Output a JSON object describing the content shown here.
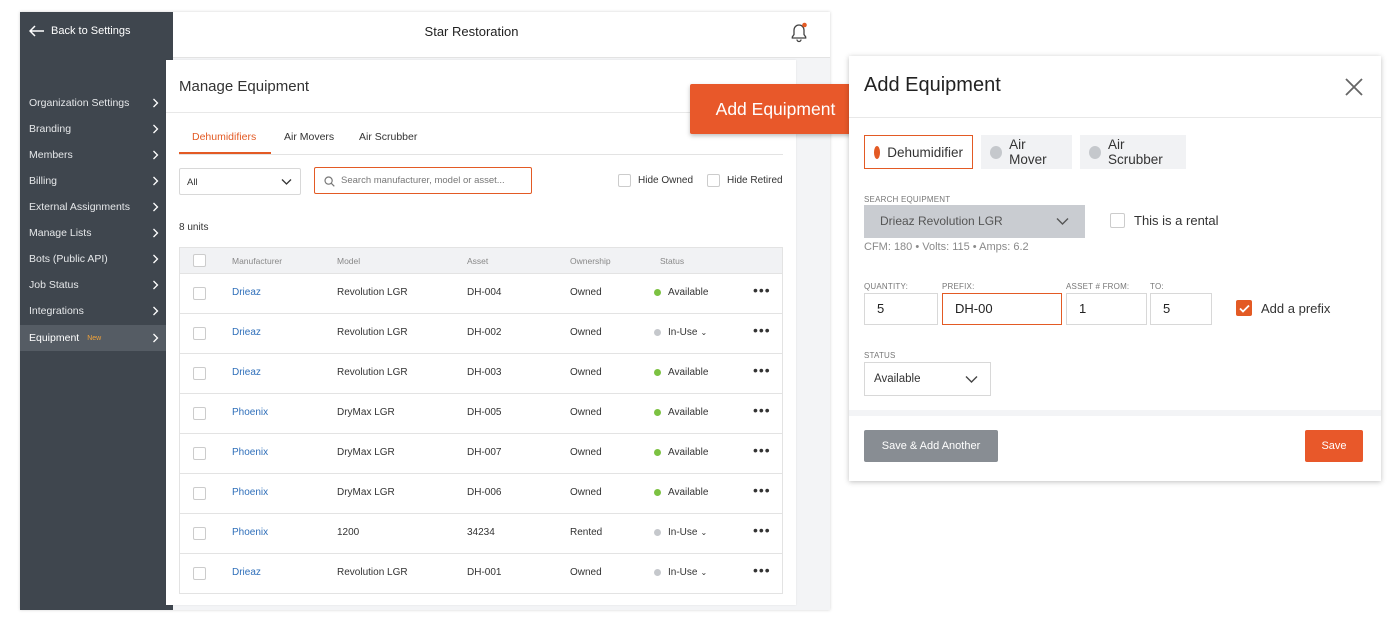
{
  "sidebar": {
    "back_label": "Back to Settings",
    "items": [
      {
        "label": "Organization Settings"
      },
      {
        "label": "Branding"
      },
      {
        "label": "Members"
      },
      {
        "label": "Billing"
      },
      {
        "label": "External Assignments"
      },
      {
        "label": "Manage Lists"
      },
      {
        "label": "Bots (Public API)"
      },
      {
        "label": "Job Status"
      },
      {
        "label": "Integrations"
      },
      {
        "label": "Equipment",
        "badge": "New",
        "active": true
      }
    ]
  },
  "topbar": {
    "title": "Star Restoration",
    "notification_dot_color": "#e35a24"
  },
  "page": {
    "title": "Manage Equipment",
    "tabs": [
      {
        "label": "Dehumidifiers",
        "active": true
      },
      {
        "label": "Air Movers"
      },
      {
        "label": "Air Scrubber"
      }
    ],
    "filter_value": "All",
    "search_placeholder": "Search manufacturer, model or asset...",
    "hide_owned_label": "Hide Owned",
    "hide_retired_label": "Hide Retired",
    "unit_count": "8 units"
  },
  "table": {
    "columns": [
      "Manufacturer",
      "Model",
      "Asset",
      "Ownership",
      "Status"
    ],
    "rows": [
      {
        "manufacturer": "Drieaz",
        "model": "Revolution LGR",
        "asset": "DH-004",
        "ownership": "Owned",
        "status": "Available"
      },
      {
        "manufacturer": "Drieaz",
        "model": "Revolution LGR",
        "asset": "DH-002",
        "ownership": "Owned",
        "status": "In-Use"
      },
      {
        "manufacturer": "Drieaz",
        "model": "Revolution LGR",
        "asset": "DH-003",
        "ownership": "Owned",
        "status": "Available"
      },
      {
        "manufacturer": "Phoenix",
        "model": "DryMax LGR",
        "asset": "DH-005",
        "ownership": "Owned",
        "status": "Available"
      },
      {
        "manufacturer": "Phoenix",
        "model": "DryMax LGR",
        "asset": "DH-007",
        "ownership": "Owned",
        "status": "Available"
      },
      {
        "manufacturer": "Phoenix",
        "model": "DryMax LGR",
        "asset": "DH-006",
        "ownership": "Owned",
        "status": "Available"
      },
      {
        "manufacturer": "Phoenix",
        "model": "1200",
        "asset": "34234",
        "ownership": "Rented",
        "status": "In-Use"
      },
      {
        "manufacturer": "Drieaz",
        "model": "Revolution LGR",
        "asset": "DH-001",
        "ownership": "Owned",
        "status": "In-Use"
      }
    ],
    "status_colors": {
      "Available": "#7cc242",
      "In-Use": "#c5c8cc"
    }
  },
  "callout": {
    "add_equipment_label": "Add Equipment"
  },
  "modal": {
    "title": "Add Equipment",
    "types": [
      {
        "label": "Dehumidifier",
        "active": true
      },
      {
        "label": "Air Mover"
      },
      {
        "label": "Air Scrubber"
      }
    ],
    "search_label": "SEARCH EQUIPMENT",
    "selected_equipment": "Drieaz Revolution LGR",
    "rental_label": "This is a rental",
    "specs": "CFM: 180 • Volts: 115 • Amps: 6.2",
    "quantity_label": "QUANTITY:",
    "quantity_value": "5",
    "prefix_label": "PREFIX:",
    "prefix_value": "DH-00",
    "asset_from_label": "ASSET # FROM:",
    "asset_from_value": "1",
    "to_label": "TO:",
    "to_value": "5",
    "add_prefix_label": "Add a prefix",
    "status_label": "STATUS",
    "status_value": "Available",
    "save_another_label": "Save & Add Another",
    "save_label": "Save"
  },
  "colors": {
    "accent": "#e35a24",
    "sidebar": "#3f464e",
    "link": "#2f6fba"
  }
}
